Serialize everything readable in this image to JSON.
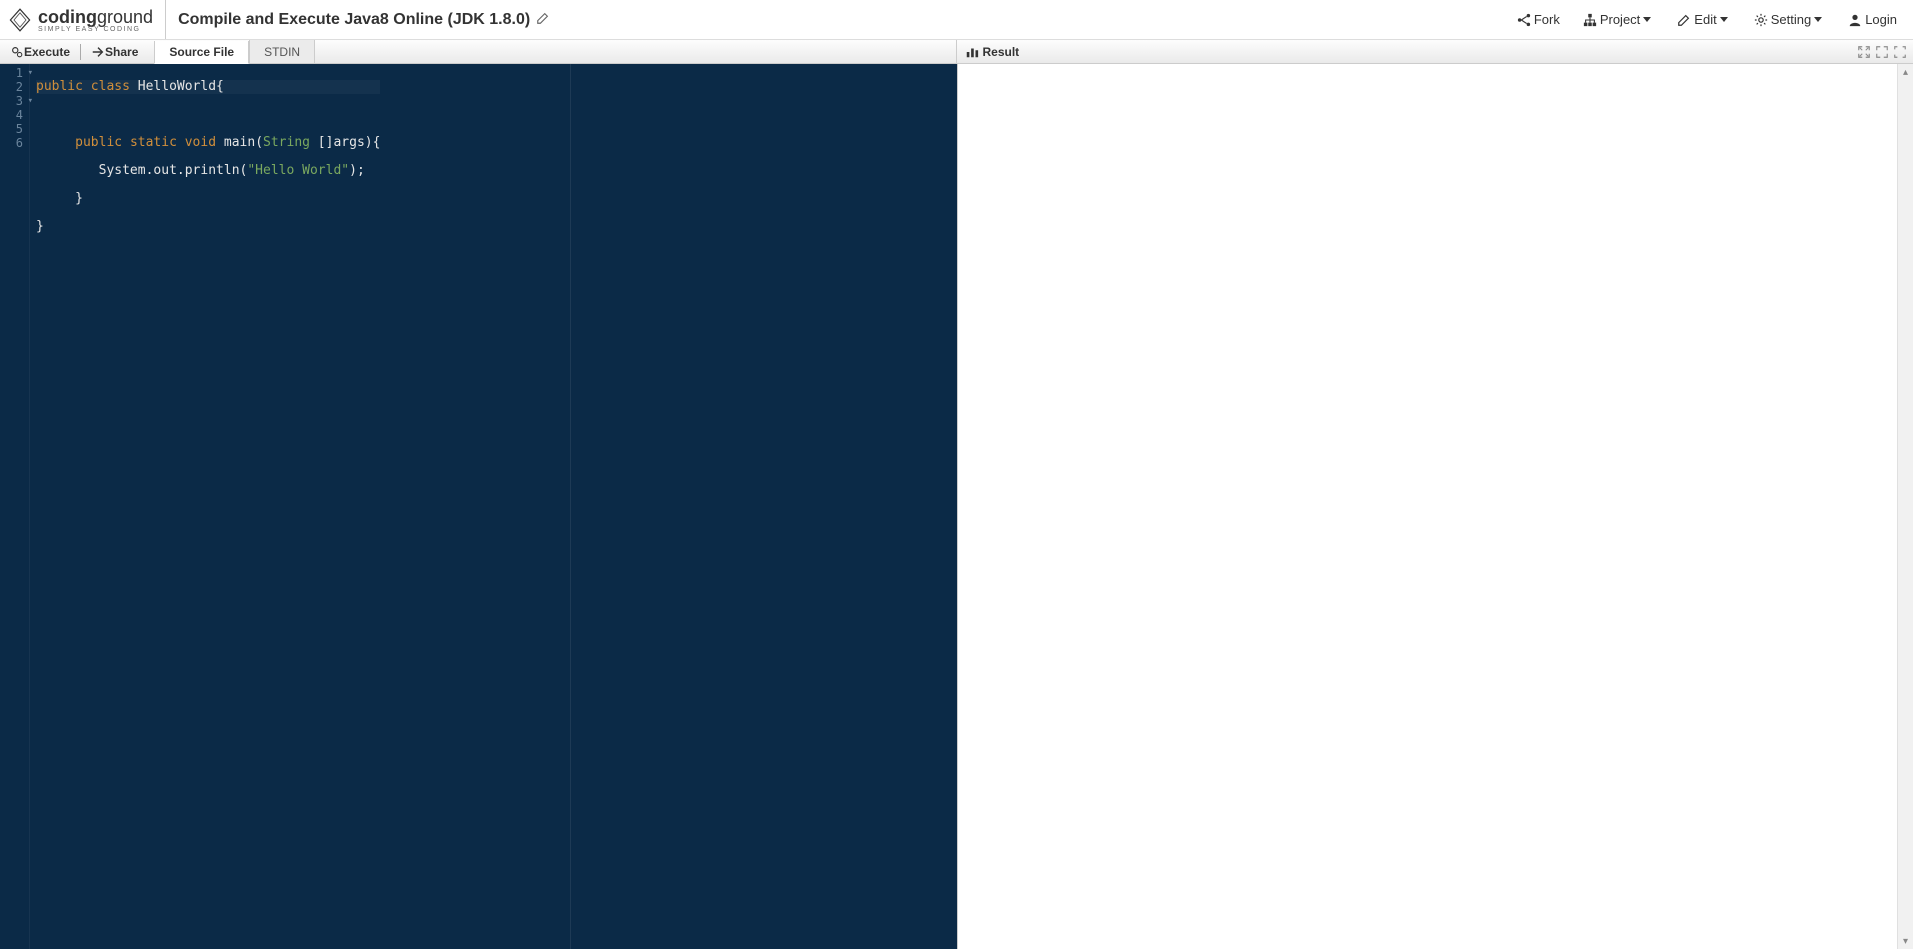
{
  "brand": {
    "name_bold": "coding",
    "name_light": "ground",
    "tagline": "SIMPLY EASY CODING"
  },
  "page_title": "Compile and Execute Java8 Online (JDK 1.8.0)",
  "header_menu": {
    "fork": "Fork",
    "project": "Project",
    "edit": "Edit",
    "setting": "Setting",
    "login": "Login"
  },
  "toolbar": {
    "execute": "Execute",
    "share": "Share"
  },
  "tabs": {
    "source": "Source File",
    "stdin": "STDIN"
  },
  "result_label": "Result",
  "editor": {
    "line_numbers": [
      "1",
      "2",
      "3",
      "4",
      "5",
      "6"
    ],
    "fold_lines": [
      "1",
      "3"
    ],
    "tokens": {
      "l1_kw1": "public",
      "l1_kw2": "class",
      "l1_id": "HelloWorld",
      "l1_b": "{",
      "l3_kw1": "public",
      "l3_kw2": "static",
      "l3_kw3": "void",
      "l3_fn": "main",
      "l3_p1": "(",
      "l3_pt": "String",
      "l3_arr": " []",
      "l3_arg": "args",
      "l3_p2": ")",
      "l3_b": "{",
      "l4_obj": "System",
      "l4_d1": ".",
      "l4_out": "out",
      "l4_d2": ".",
      "l4_pln": "println",
      "l4_p1": "(",
      "l4_str": "\"Hello World\"",
      "l4_p2": ")",
      "l4_sc": ";",
      "l5_b": "}",
      "l6_b": "}"
    }
  }
}
